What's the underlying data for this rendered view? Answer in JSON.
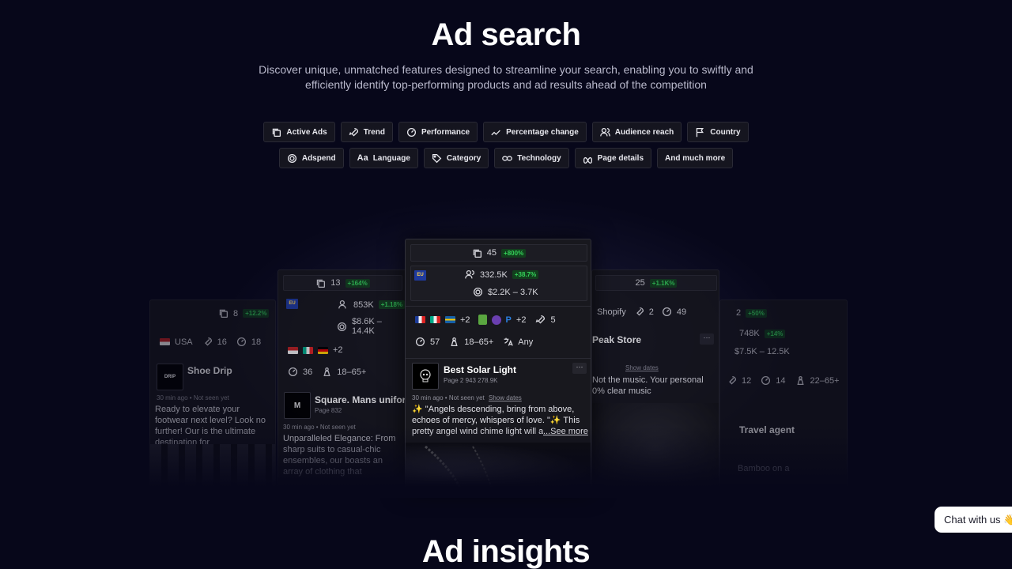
{
  "hero": {
    "title": "Ad search",
    "subtitle": "Discover unique, unmatched features designed to streamline your search, enabling you to swiftly and efficiently identify top-performing products and ad results ahead of the competition"
  },
  "features_row1": [
    "Active Ads",
    "Trend",
    "Performance",
    "Percentage change",
    "Audience reach",
    "Country"
  ],
  "features_row2": [
    "Adspend",
    "Language",
    "Category",
    "Technology",
    "Page details",
    "And much more"
  ],
  "main_card": {
    "active_ads": "45",
    "active_change": "+800%",
    "region": "EU",
    "reach": "332.5K",
    "reach_change": "+38.7%",
    "spend": "$2.2K – 3.7K",
    "extra_countries": "+2",
    "extra_tech": "+2",
    "trend": "5",
    "performance": "57",
    "age": "18–65+",
    "language": "Any",
    "page_name": "Best Solar Light",
    "page_meta": "Page  2  943  278.9K",
    "time": "30 min ago • Not seen yet",
    "show_dates": "Show dates",
    "desc": "✨ \"Angels descending, bring from above, echoes of mercy, whispers of love. \"✨ This pretty angel wind chime light will a",
    "see_more": "...See more"
  },
  "card_left_far": {
    "active_ads": "8",
    "change": "+12.2%",
    "country": "USA",
    "trend": "16",
    "perf": "18",
    "page_name": "Shoe Drip",
    "time": "30 min ago • Not seen yet",
    "desc": "Ready to elevate your footwear next level? Look no further! Our is the ultimate destination for"
  },
  "card_left": {
    "active_ads": "13",
    "change": "+164%",
    "region": "EU",
    "reach": "853K",
    "reach_change": "+1.18%",
    "spend": "$8.6K – 14.4K",
    "extra_countries": "+2",
    "perf": "36",
    "age": "18–65+",
    "page_name": "Square. Mans uniform",
    "page_meta": "Page  832",
    "time": "30 min ago • Not seen yet",
    "desc": "Unparalleled Elegance: From sharp suits to casual-chic ensembles, our boasts an array of clothing that"
  },
  "card_right": {
    "active_ads": "25",
    "change": "+1.1K%",
    "platform": "Shopify",
    "trend": "2",
    "perf": "49",
    "page_name": "Peak Store",
    "show_dates": "Show dates",
    "desc": "Not the music. Your personal 0% clear music"
  },
  "card_right_far": {
    "active_ads": "2",
    "change": "+50%",
    "reach": "748K",
    "reach_change": "+14%",
    "spend": "$7.5K – 12.5K",
    "trend": "12",
    "perf": "14",
    "age": "22–65+",
    "page_name": "Travel agent",
    "desc": "Bamboo on a"
  },
  "insights_title": "Ad insights",
  "chat_label": "Chat with us 👋"
}
